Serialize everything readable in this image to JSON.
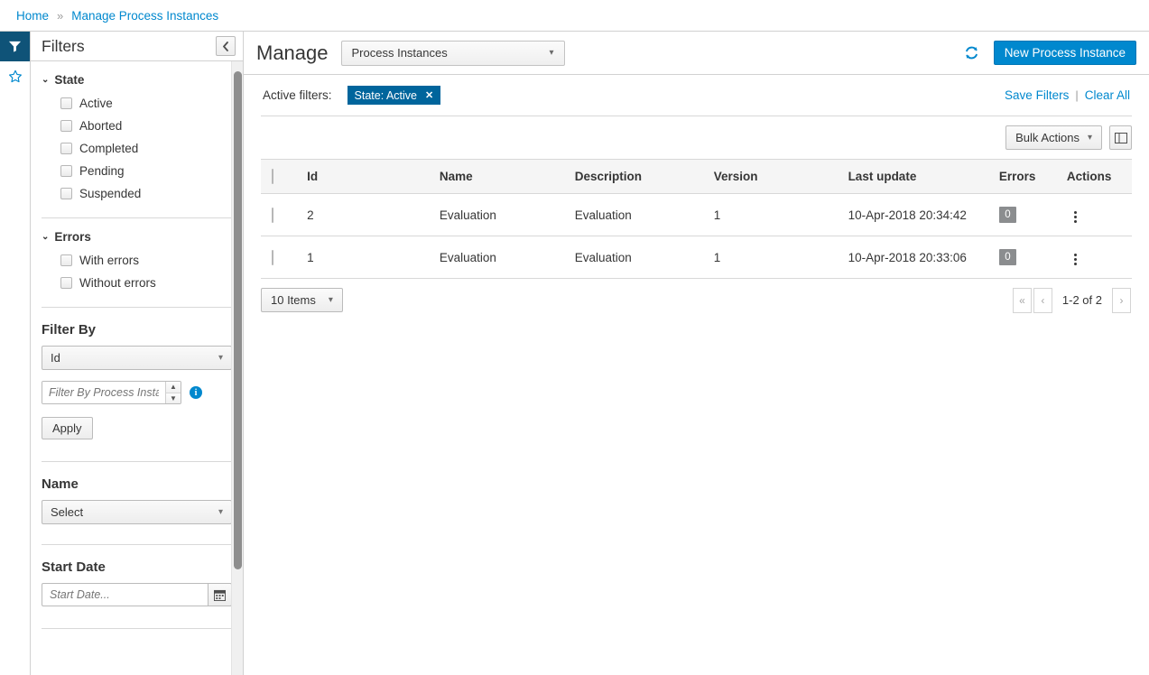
{
  "breadcrumb": {
    "home": "Home",
    "separator": "»",
    "current": "Manage Process Instances"
  },
  "rail": {
    "filter_icon": "filter-icon",
    "star_icon": "star-icon"
  },
  "sidebar": {
    "title": "Filters",
    "collapse_label": "‹",
    "groups": [
      {
        "label": "State",
        "caret": "⌄",
        "items": [
          {
            "label": "Active",
            "checked": false
          },
          {
            "label": "Aborted",
            "checked": false
          },
          {
            "label": "Completed",
            "checked": false
          },
          {
            "label": "Pending",
            "checked": false
          },
          {
            "label": "Suspended",
            "checked": false
          }
        ]
      },
      {
        "label": "Errors",
        "caret": "⌄",
        "items": [
          {
            "label": "With errors",
            "checked": false
          },
          {
            "label": "Without errors",
            "checked": false
          }
        ]
      }
    ],
    "filter_by": {
      "title": "Filter By",
      "select_value": "Id",
      "input_value": "",
      "input_placeholder": "Filter By Process Instance Id",
      "info_glyph": "i",
      "apply_label": "Apply"
    },
    "name": {
      "title": "Name",
      "select_value": "Select"
    },
    "start_date": {
      "title": "Start Date",
      "input_value": "",
      "input_placeholder": "Start Date..."
    }
  },
  "header": {
    "title": "Manage",
    "entity_select_value": "Process Instances",
    "refresh_icon": "refresh-icon",
    "new_button_label": "New Process Instance"
  },
  "filters_bar": {
    "label": "Active filters:",
    "chips": [
      {
        "label": "State: Active",
        "close": "✕"
      }
    ],
    "save_filters_label": "Save Filters",
    "separator": "|",
    "clear_all_label": "Clear All"
  },
  "toolbar": {
    "bulk_actions_label": "Bulk Actions",
    "bulk_actions_caret": "⌄",
    "columns_icon": "columns-toggle-icon"
  },
  "table": {
    "columns": [
      "Id",
      "Name",
      "Description",
      "Version",
      "Last update",
      "Errors",
      "Actions"
    ],
    "rows": [
      {
        "id": "2",
        "name": "Evaluation",
        "description": "Evaluation",
        "version": "1",
        "last_update": "10-Apr-2018 20:34:42",
        "errors": "0"
      },
      {
        "id": "1",
        "name": "Evaluation",
        "description": "Evaluation",
        "version": "1",
        "last_update": "10-Apr-2018 20:33:06",
        "errors": "0"
      }
    ]
  },
  "pagination": {
    "page_size_label": "10 Items",
    "page_size_caret": "⌄",
    "first_label": "«",
    "prev_label": "‹",
    "range_label": "1-2 of 2",
    "next_label": "›"
  },
  "colors": {
    "accent_blue": "#0088ce",
    "chip_blue": "#00659c",
    "rail_active": "#0f5378",
    "badge_gray": "#8b8d8f"
  }
}
